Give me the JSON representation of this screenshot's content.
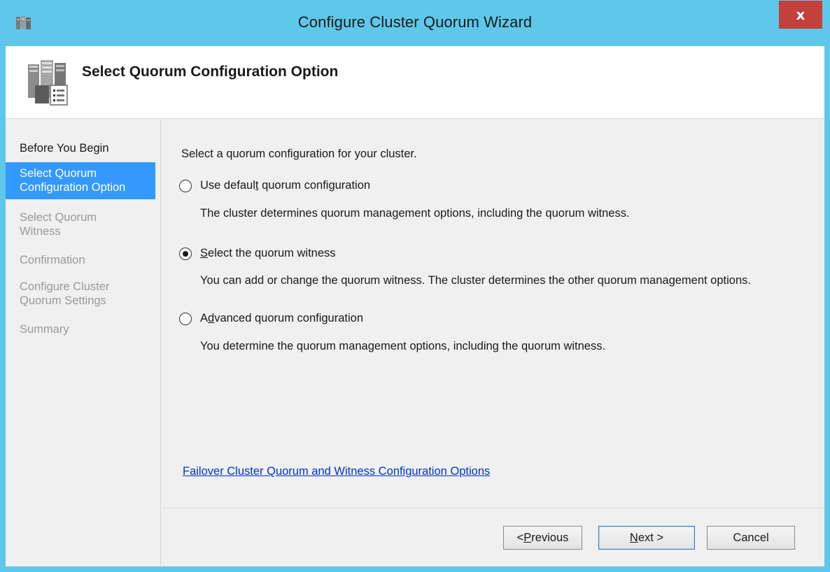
{
  "window": {
    "title": "Configure Cluster Quorum Wizard",
    "close_glyph": "x"
  },
  "header": {
    "title": "Select Quorum Configuration Option",
    "icon": "cluster-servers-icon"
  },
  "sidebar": {
    "items": [
      {
        "label": "Before You Begin",
        "state": "done"
      },
      {
        "label_line1": "Select Quorum",
        "label_line2": "Configuration Option",
        "state": "active"
      },
      {
        "label_line1": "Select Quorum",
        "label_line2": "Witness",
        "state": "pending"
      },
      {
        "label": "Confirmation",
        "state": "pending"
      },
      {
        "label_line1": "Configure Cluster",
        "label_line2": "Quorum Settings",
        "state": "pending"
      },
      {
        "label": "Summary",
        "state": "pending"
      }
    ]
  },
  "main": {
    "intro": "Select a quorum configuration for your cluster.",
    "options": [
      {
        "label_pre": "Use defaul",
        "label_key": "t",
        "label_post": " quorum configuration",
        "checked": false,
        "description": "The cluster determines quorum management options, including the quorum witness."
      },
      {
        "label_pre": "",
        "label_key": "S",
        "label_post": "elect the quorum witness",
        "checked": true,
        "description": "You can add or change the quorum witness. The cluster determines the other quorum management options."
      },
      {
        "label_pre": "A",
        "label_key": "d",
        "label_post": "vanced quorum configuration",
        "checked": false,
        "description": "You determine the quorum management options, including the quorum witness."
      }
    ],
    "help_link": "Failover Cluster Quorum and Witness Configuration Options"
  },
  "buttons": {
    "previous_pre": "< ",
    "previous_key": "P",
    "previous_post": "revious",
    "next_key": "N",
    "next_post": "ext >",
    "cancel": "Cancel"
  },
  "colors": {
    "titlebar": "#5ec8ea",
    "selection": "#3399ff",
    "link": "#0033cc",
    "close": "#c4403b"
  }
}
